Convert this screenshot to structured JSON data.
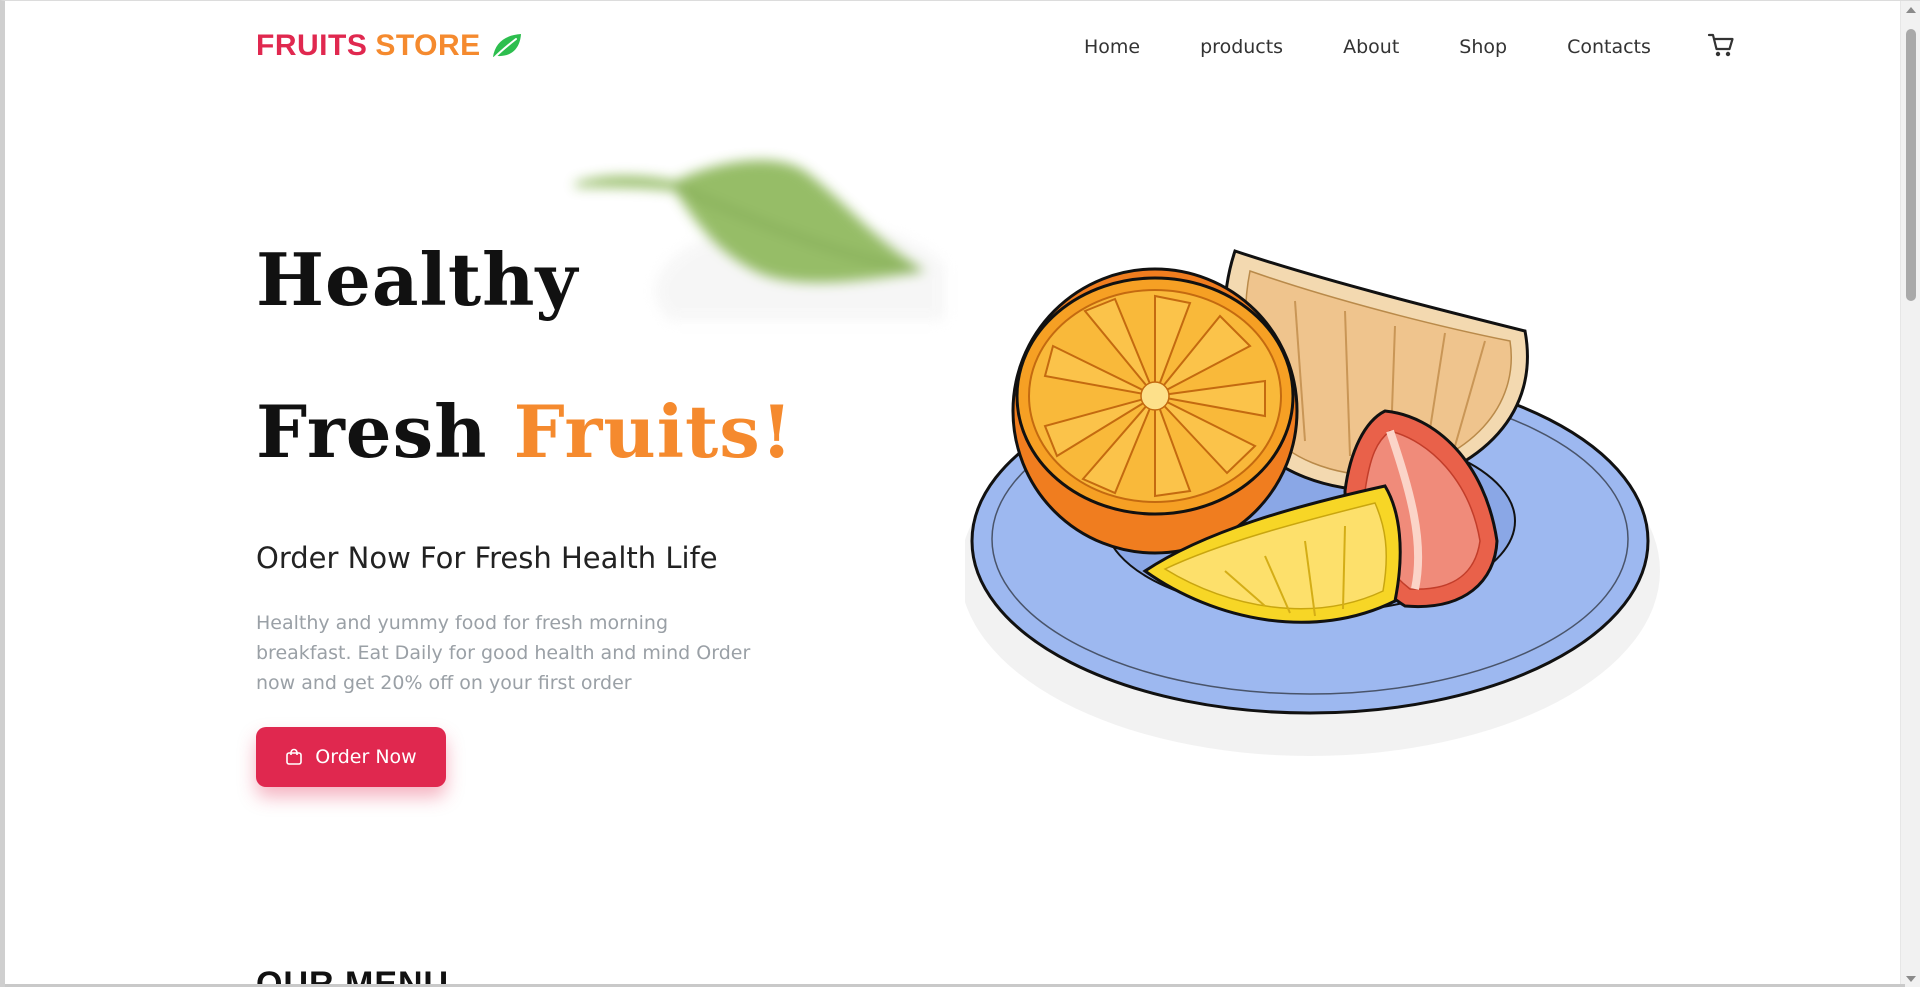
{
  "colors": {
    "brand_red": "#E0284F",
    "brand_orange": "#F58A2E",
    "brand_green": "#2DBE4E",
    "plate_blue": "#9DB8F0"
  },
  "header": {
    "logo": {
      "word1": "FRUITS",
      "word2": "STORE",
      "icon": "leaf-icon"
    },
    "nav": [
      {
        "label": "Home"
      },
      {
        "label": "products"
      },
      {
        "label": "About"
      },
      {
        "label": "Shop"
      },
      {
        "label": "Contacts"
      }
    ],
    "cart_icon": "shopping-cart-icon"
  },
  "hero": {
    "title_line1": "Healthy",
    "title_line2_word": "Fresh",
    "title_line2_accent": "Fruits!",
    "subtitle": "Order Now For Fresh Health Life",
    "description": "Healthy and yummy food for fresh morning breakfast. Eat Daily for good health and mind Order now and get 20% off on your first order",
    "cta": {
      "label": "Order Now",
      "icon": "shopping-bag-icon"
    },
    "image": "fruit-plate-illustration"
  },
  "next_section": {
    "heading": "OUR MENU"
  }
}
